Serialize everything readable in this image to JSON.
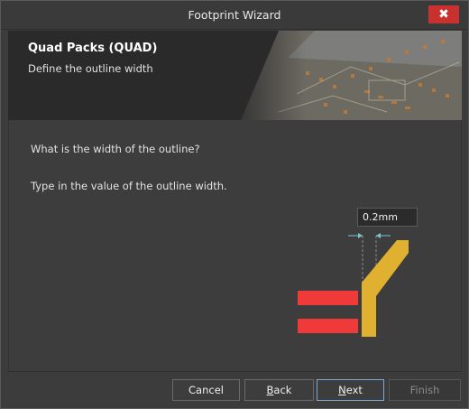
{
  "window": {
    "title": "Footprint Wizard",
    "close_glyph": "✖"
  },
  "header": {
    "title": "Quad Packs (QUAD)",
    "subtitle": "Define the outline width"
  },
  "content": {
    "question": "What is the width of the outline?",
    "instruction": "Type in the value of the outline width.",
    "outline_width_value": "0.2mm"
  },
  "colors": {
    "accent_pad": "#f03a3a",
    "outline": "#e0b030",
    "dimension": "#7fc6c8",
    "next_focus": "#7fa9d4"
  },
  "buttons": {
    "cancel": "Cancel",
    "back_prefix": "",
    "back_mnemonic": "B",
    "back_rest": "ack",
    "next_mnemonic": "N",
    "next_rest": "ext",
    "finish": "Finish"
  }
}
